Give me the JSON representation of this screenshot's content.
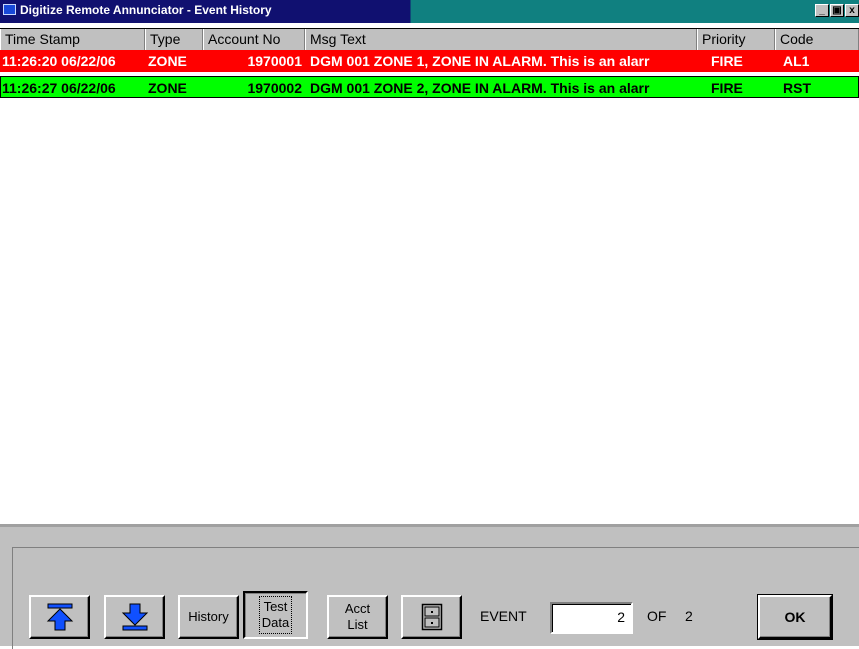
{
  "window": {
    "title": "Digitize Remote Annunciator - Event History",
    "buttons": {
      "minimize": "_",
      "maximize": "▣",
      "close": "x"
    }
  },
  "table": {
    "columns": [
      "Time Stamp",
      "Type",
      "Account No",
      "Msg Text",
      "Priority",
      "Code"
    ],
    "rows": [
      {
        "time_stamp": "11:26:20 06/22/06",
        "type": "ZONE",
        "account_no": "1970001",
        "msg_text": "DGM 001 ZONE 1, ZONE IN ALARM. This is an alarr",
        "priority": "FIRE",
        "code": "AL1",
        "bg_color": "#ff0000",
        "text_color": "#ffffff",
        "selected": false
      },
      {
        "time_stamp": "11:26:27 06/22/06",
        "type": "ZONE",
        "account_no": "1970002",
        "msg_text": "DGM 001 ZONE 2, ZONE IN ALARM. This is an alarr",
        "priority": "FIRE",
        "code": "RST",
        "bg_color": "#00ff00",
        "text_color": "#000000",
        "selected": true
      }
    ]
  },
  "toolbar": {
    "first_icon": "arrow-to-top-icon",
    "last_icon": "arrow-to-bottom-icon",
    "history_label": "History",
    "test_data_label": "Test\nData",
    "acct_list_label": "Acct\nList",
    "cabinet_icon": "file-cabinet-icon",
    "event_label": "EVENT",
    "event_value": "2",
    "of_label": "OF",
    "total": "2",
    "ok_label": "OK"
  },
  "colors": {
    "title_active": "#101070",
    "title_inactive": "#108080",
    "alarm_row": "#ff0000",
    "restore_row": "#00ff00",
    "icon_blue": "#1050ff"
  }
}
